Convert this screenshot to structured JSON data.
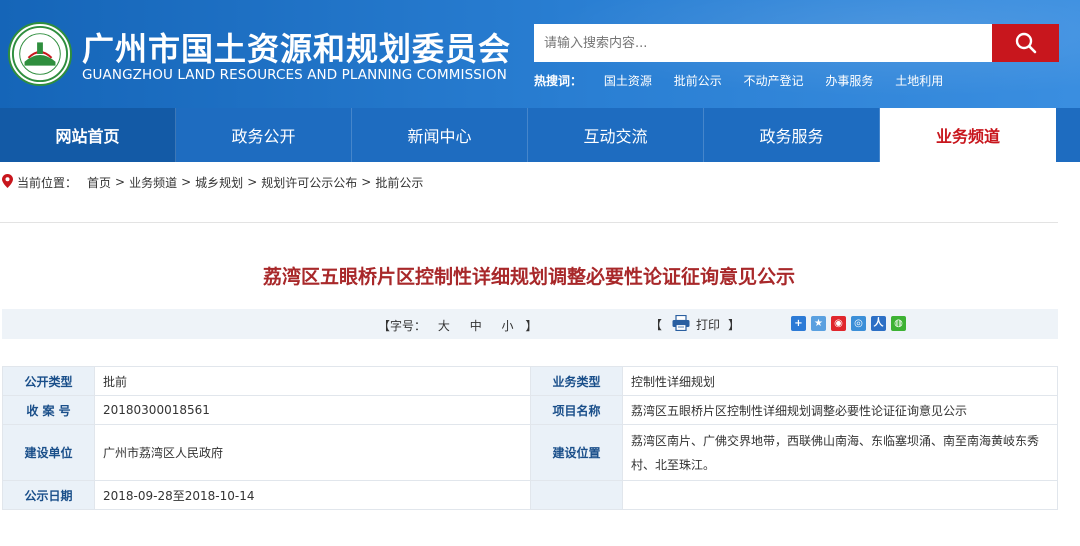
{
  "header": {
    "title_cn": "广州市国土资源和规划委员会",
    "title_en": "GUANGZHOU LAND RESOURCES AND PLANNING COMMISSION",
    "logo_text": "广州国土规划",
    "search_placeholder": "请输入搜索内容...",
    "hot_label": "热搜词：",
    "hot_words": [
      "国土资源",
      "批前公示",
      "不动产登记",
      "办事服务",
      "土地利用"
    ]
  },
  "nav": {
    "items": [
      "网站首页",
      "政务公开",
      "新闻中心",
      "互动交流",
      "政务服务",
      "业务频道"
    ],
    "active_index": 5
  },
  "breadcrumb": {
    "label": "当前位置：",
    "items": [
      "首页",
      "业务频道",
      "城乡规划",
      "规划许可公示公布",
      "批前公示"
    ],
    "separator": ">"
  },
  "article": {
    "title": "荔湾区五眼桥片区控制性详细规划调整必要性论证征询意见公示"
  },
  "tools": {
    "fontsize_open": "【字号：",
    "fontsize_options": [
      "大",
      "中",
      "小"
    ],
    "fontsize_close": "】",
    "print_open": "【",
    "print_label": "打印",
    "print_close": "】"
  },
  "info": {
    "rows": [
      {
        "k1": "公开类型",
        "v1": "批前",
        "k2": "业务类型",
        "v2": "控制性详细规划"
      },
      {
        "k1": "收 案 号",
        "v1": "20180300018561",
        "k2": "项目名称",
        "v2": "荔湾区五眼桥片区控制性详细规划调整必要性论证征询意见公示"
      },
      {
        "k1": "建设单位",
        "v1": "广州市荔湾区人民政府",
        "k2": "建设位置",
        "v2": "荔湾区南片、广佛交界地带，西联佛山南海、东临塞坝涌、南至南海黄岐东秀村、北至珠江。"
      },
      {
        "k1": "公示日期",
        "v1": "2018-09-28至2018-10-14",
        "k2": "",
        "v2": ""
      }
    ]
  },
  "colors": {
    "header_blue": "#1e6cc0",
    "accent_red": "#c8161d",
    "title_red": "#a8282a",
    "key_bg": "#eaf1f8",
    "key_text": "#1a4f8a"
  }
}
